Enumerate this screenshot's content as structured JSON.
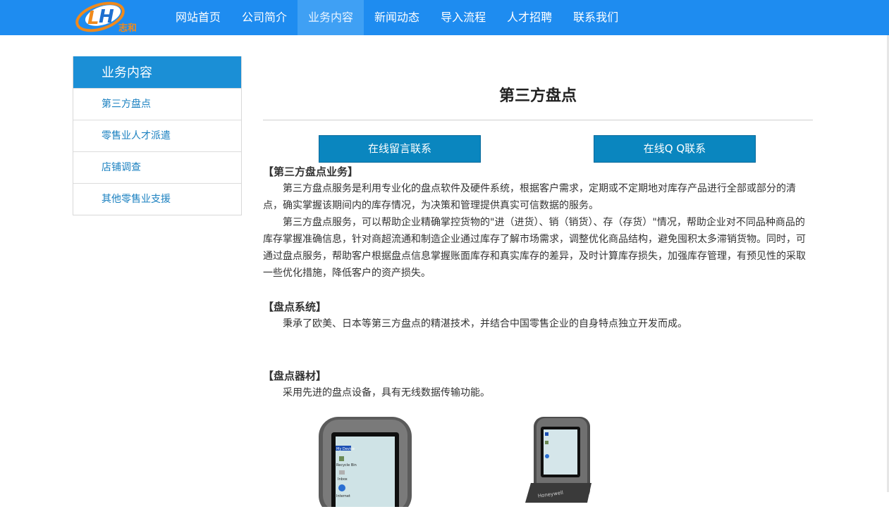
{
  "header": {
    "logo_text": "志和",
    "nav": [
      "网站首页",
      "公司简介",
      "业务内容",
      "新闻动态",
      "导入流程",
      "人才招聘",
      "联系我们"
    ],
    "active_index": 2,
    "bg_color": "#1e8cf0"
  },
  "sidebar": {
    "title": "业务内容",
    "items": [
      "第三方盘点",
      "零售业人才派遣",
      "店铺调查",
      "其他零售业支援"
    ]
  },
  "main": {
    "title": "第三方盘点",
    "buttons": [
      "在线留言联系",
      "在线Q Q联系"
    ],
    "sections": [
      {
        "heading": "【第三方盘点业务】",
        "paragraphs": [
          "第三方盘点服务是利用专业化的盘点软件及硬件系统，根据客户需求，定期或不定期地对库存产品进行全部或部分的清点，确实掌握该期间内的库存情况，为决策和管理提供真实可信数据的服务。",
          "第三方盘点服务，可以帮助企业精确掌控货物的\"进（进货）、销（销货）、存（存货）\"情况，帮助企业对不同品种商品的库存掌握准确信息，针对商超流通和制造企业通过库存了解市场需求，调整优化商品结构，避免囤积太多滞销货物。同时，可通过盘点服务，帮助客户根据盘点信息掌握账面库存和真实库存的差异，及时计算库存损失，加强库存管理，有预见性的采取一些优化措施，降低客户的资产损失。"
        ]
      },
      {
        "heading": "【盘点系统】",
        "paragraphs": [
          "秉承了欧美、日本等第三方盘点的精湛技术，并结合中国零售企业的自身特点独立开发而成。"
        ]
      },
      {
        "heading": "【盘点器材】",
        "paragraphs": [
          "采用先进的盘点设备，具有无线数据传输功能。"
        ]
      }
    ],
    "device_screen_labels": [
      "My Device",
      "Recycle Bin",
      "Inbox",
      "Internet"
    ],
    "device_brand": "Honeywell"
  }
}
